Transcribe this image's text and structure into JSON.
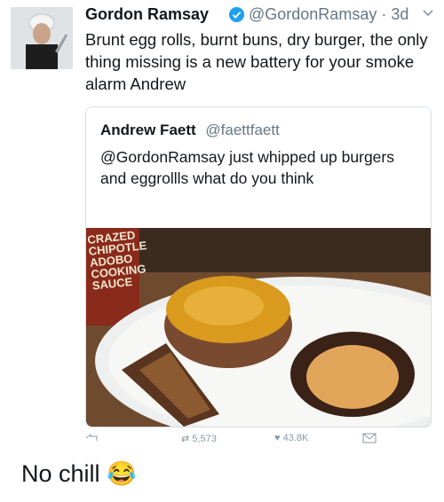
{
  "tweet": {
    "name": "Gordon Ramsay",
    "handle": "@GordonRamsay",
    "time": "· 3d",
    "text": "Brunt egg rolls, burnt buns, dry burger, the only thing missing is a new battery for your smoke alarm Andrew"
  },
  "quoted": {
    "name": "Andrew Faett",
    "handle": "@faettfaett",
    "text": "@GordonRamsay just whipped up burgers and eggrollls what do you think",
    "photo_bottle_label": "CRAZED CHIPOTLE ADOBO COOKING SAUCE"
  },
  "actions": {
    "reply": "",
    "retweet_count": "5,573",
    "like_count": "43.8K"
  },
  "caption": {
    "text": "No chill",
    "emoji": "😂"
  },
  "icons": [
    "verified-icon",
    "caret-down-icon",
    "reply-icon",
    "retweet-icon",
    "like-icon",
    "dm-icon"
  ],
  "colors": {
    "verified": "#1da1f2",
    "secondary_text": "#657786",
    "border": "#d8dee3"
  }
}
